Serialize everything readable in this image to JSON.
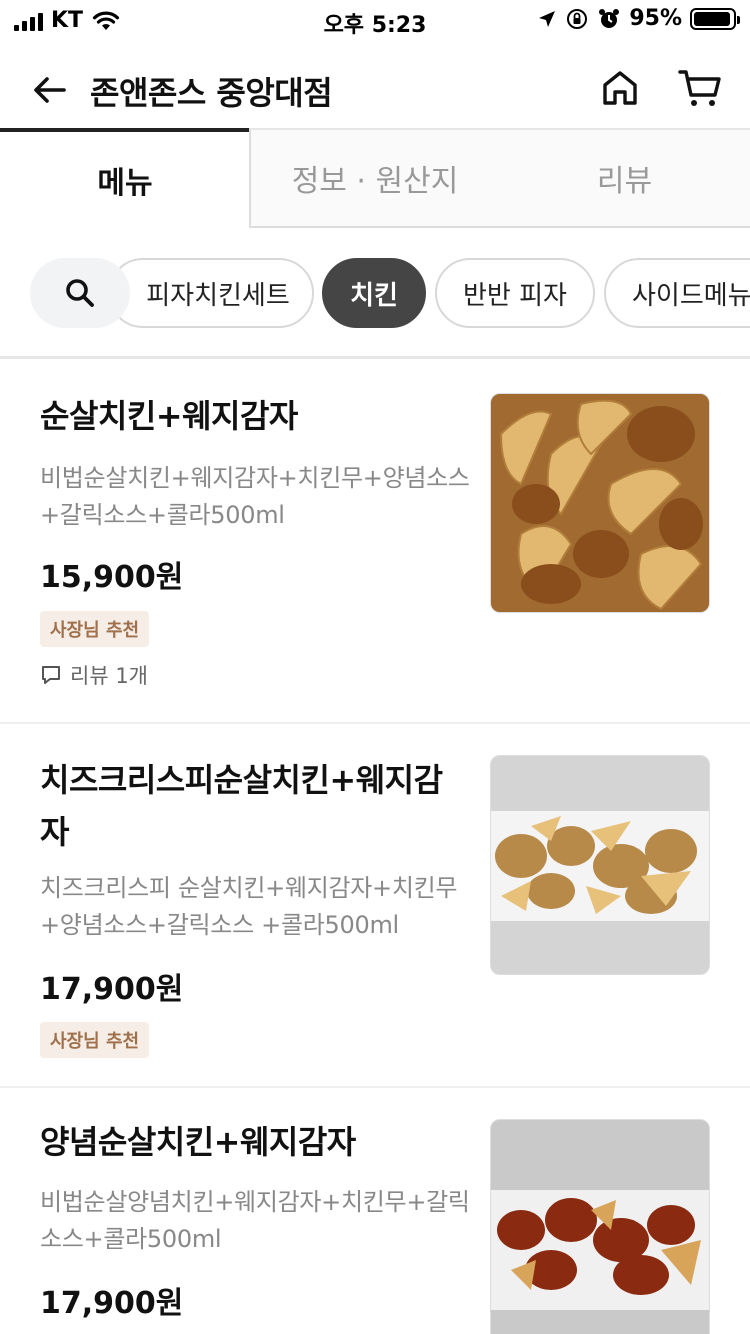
{
  "status_bar": {
    "carrier": "KT",
    "time": "오후 5:23",
    "battery": "95%",
    "battery_level": 0.95
  },
  "header": {
    "title": "존앤존스 중앙대점",
    "back_icon": "arrow-left-icon",
    "home_icon": "home-icon",
    "cart_icon": "cart-icon"
  },
  "tabs": [
    {
      "label": "메뉴",
      "active": true
    },
    {
      "label": "정보 · 원산지",
      "active": false
    },
    {
      "label": "리뷰",
      "active": false
    }
  ],
  "categories": {
    "search_icon": "search-icon",
    "items": [
      {
        "label": "피자치킨세트",
        "active": false
      },
      {
        "label": "치킨",
        "active": true
      },
      {
        "label": "반반 피자",
        "active": false
      },
      {
        "label": "사이드메뉴",
        "active": false
      }
    ]
  },
  "menu_items": [
    {
      "name": "순살치킨+웨지감자",
      "description": "비법순살치킨+웨지감자+치킨무+양념소스+갈릭소스+콜라500ml",
      "price": "15,900원",
      "badge": "사장님 추천",
      "review": "리뷰 1개"
    },
    {
      "name": "치즈크리스피순살치킨+웨지감자",
      "description": "치즈크리스피 순살치킨+웨지감자+치킨무+양념소스+갈릭소스 +콜라500ml",
      "price": "17,900원",
      "badge": "사장님 추천"
    },
    {
      "name": "양념순살치킨+웨지감자",
      "description": "비법순살양념치킨+웨지감자+치킨무+갈릭소스+콜라500ml",
      "price": "17,900원"
    }
  ],
  "colors": {
    "accent_dark": "#454545",
    "badge_bg": "#f5ede6",
    "badge_text": "#a0704c"
  }
}
